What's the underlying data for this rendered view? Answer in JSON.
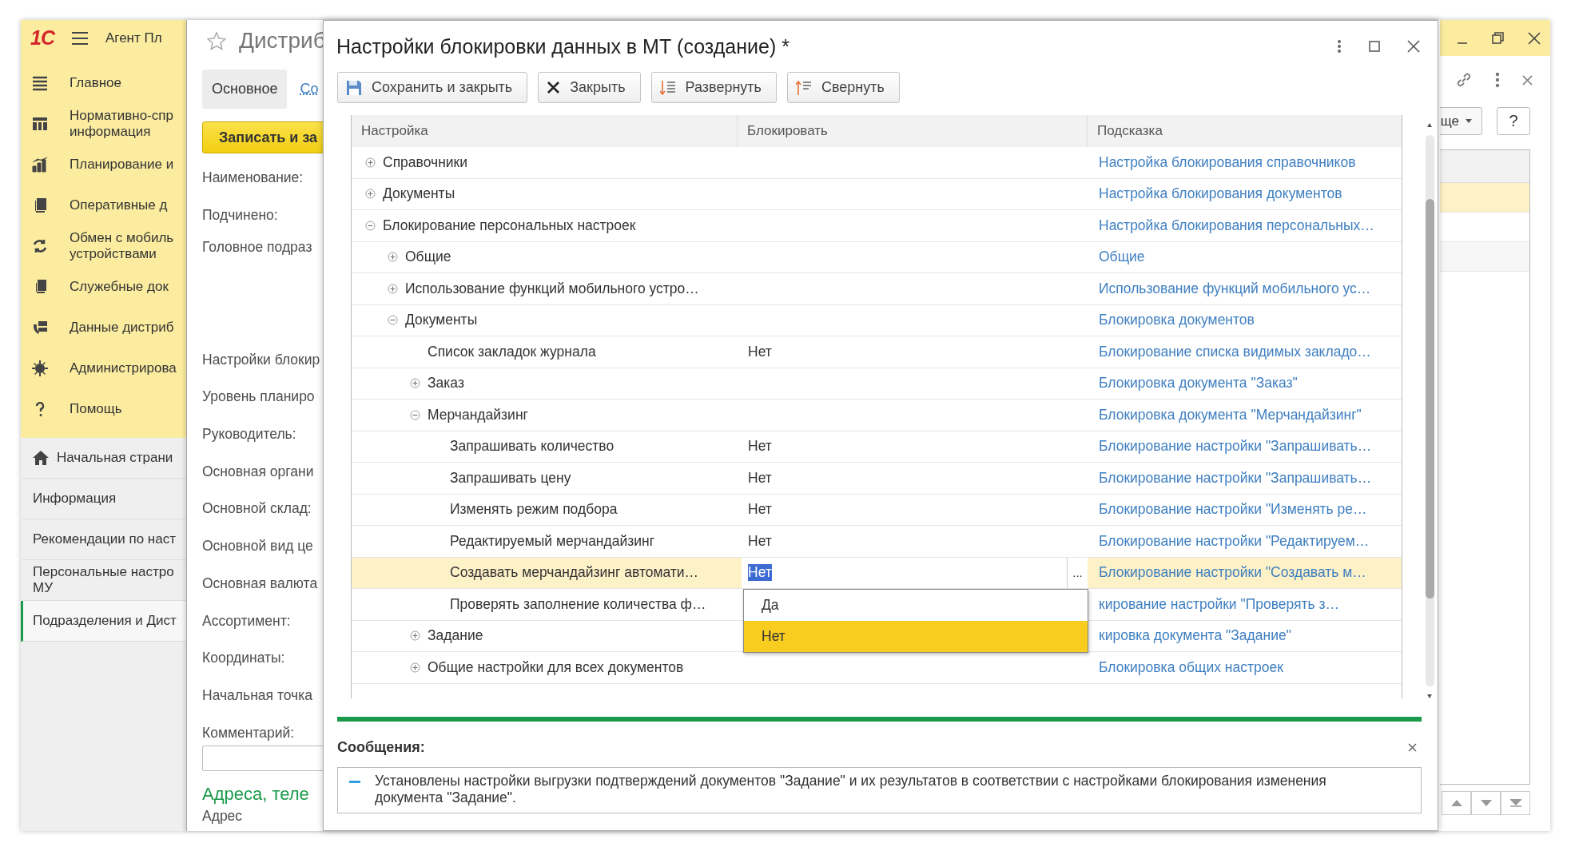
{
  "app": {
    "logo": "1С",
    "title": "Агент Пл"
  },
  "sidebar": {
    "sections": [
      {
        "lines": [
          "Главное"
        ]
      },
      {
        "lines": [
          "Нормативно-спр",
          "информация"
        ]
      },
      {
        "lines": [
          "Планирование и"
        ]
      },
      {
        "lines": [
          "Оперативные д"
        ]
      },
      {
        "lines": [
          "Обмен с мобиль",
          "устройствами"
        ]
      },
      {
        "lines": [
          "Служебные док"
        ]
      },
      {
        "lines": [
          "Данные дистриб"
        ]
      },
      {
        "lines": [
          "Администрирова"
        ]
      },
      {
        "lines": [
          "Помощь"
        ]
      }
    ],
    "pages": [
      {
        "lines": [
          "Начальная страни"
        ],
        "selected": false
      },
      {
        "lines": [
          "Информация"
        ],
        "selected": false
      },
      {
        "lines": [
          "Рекомендации по наст"
        ],
        "selected": false
      },
      {
        "lines": [
          "Персональные настро",
          "МУ"
        ],
        "selected": false
      },
      {
        "lines": [
          "Подразделения и Дист"
        ],
        "selected": true
      }
    ]
  },
  "list_form": {
    "more_button": "ще",
    "help_button": "?"
  },
  "back_form": {
    "title": "Дистриб",
    "tabs": [
      {
        "label": "Основное",
        "selected": true
      },
      {
        "label": "Со",
        "selected": false
      }
    ],
    "save_button": "Записать и за",
    "labels": [
      "Наименование:",
      "Подчинено:",
      "Головное подраз",
      "Настройки блокир",
      "Уровень планиро",
      "Руководитель:",
      "Основная органи",
      "Основной склад:",
      "Основной вид це",
      "Основная валюта",
      "Ассортимент:",
      "Координаты:",
      "Начальная точка",
      "Комментарий:"
    ],
    "section_title": "Адреса, теле",
    "address_label": "Адрес"
  },
  "dialog": {
    "title": "Настройки блокировки данных в МТ (создание) *",
    "toolbar": [
      "Сохранить и закрыть",
      "Закрыть",
      "Развернуть",
      "Свернуть"
    ],
    "table": {
      "columns": [
        "Настройка",
        "Блокировать",
        "Подсказка"
      ],
      "rows": [
        {
          "setting": "Справочники",
          "hint": "Настройка блокирования справочников",
          "expanded": false,
          "selected": false
        },
        {
          "setting": "Документы",
          "hint": "Настройка блокирования документов",
          "expanded": false,
          "selected": false
        },
        {
          "setting": "Блокирование персональных настроек",
          "hint": "Настройка блокирования персональных…",
          "expanded": true,
          "selected": false,
          "children": [
            {
              "setting": "Общие",
              "hint": "Общие",
              "expanded": false,
              "selected": false
            },
            {
              "setting": "Использование функций мобильного устро…",
              "hint": "Использование функций мобильного ус…",
              "expanded": false,
              "selected": false
            },
            {
              "setting": "Документы",
              "hint": "Блокировка документов",
              "expanded": true,
              "selected": false,
              "children": [
                {
                  "setting": "Список закладок журнала",
                  "value": "Нет",
                  "hint": "Блокирование списка видимых закладо…",
                  "selected": false
                },
                {
                  "setting": "Заказ",
                  "hint": "Блокировка документа \"Заказ\"",
                  "expanded": false,
                  "selected": false
                },
                {
                  "setting": "Мерчандайзинг",
                  "hint": "Блокировка документа \"Мерчандайзинг\"",
                  "expanded": true,
                  "selected": false,
                  "children": [
                    {
                      "setting": "Запрашивать количество",
                      "value": "Нет",
                      "hint": "Блокирование настройки \"Запрашивать…",
                      "selected": false
                    },
                    {
                      "setting": "Запрашивать цену",
                      "value": "Нет",
                      "hint": "Блокирование настройки \"Запрашивать…",
                      "selected": false
                    },
                    {
                      "setting": "Изменять режим подбора",
                      "value": "Нет",
                      "hint": "Блокирование настройки \"Изменять ре…",
                      "selected": false
                    },
                    {
                      "setting": "Редактируемый мерчандайзинг",
                      "value": "Нет",
                      "hint": "Блокирование настройки \"Редактируем…",
                      "selected": false
                    },
                    {
                      "setting": "Создавать мерчандайзинг автомати…",
                      "value": "Нет",
                      "hint": "Блокирование настройки \"Создавать м…",
                      "selected": true
                    },
                    {
                      "setting": "Проверять заполнение количества ф…",
                      "hint": "кирование настройки \"Проверять з…",
                      "selected": false
                    }
                  ]
                },
                {
                  "setting": "Задание",
                  "hint": "кировка документа \"Задание\"",
                  "expanded": false,
                  "selected": false
                },
                {
                  "setting": "Общие настройки для всех документов",
                  "hint": "Блокировка общих настроек",
                  "expanded": false,
                  "selected": false
                }
              ]
            }
          ]
        }
      ]
    },
    "choice_button": "...",
    "dropdown": {
      "options": [
        {
          "label": "Да",
          "selected": false
        },
        {
          "label": "Нет",
          "selected": true
        }
      ]
    },
    "messages": {
      "title": "Сообщения:",
      "items": [
        "Установлены настройки выгрузки подтверждений документов \"Задание\" и их результатов в соответствии с настройками блокирования изменения документа \"Задание\"."
      ]
    }
  }
}
